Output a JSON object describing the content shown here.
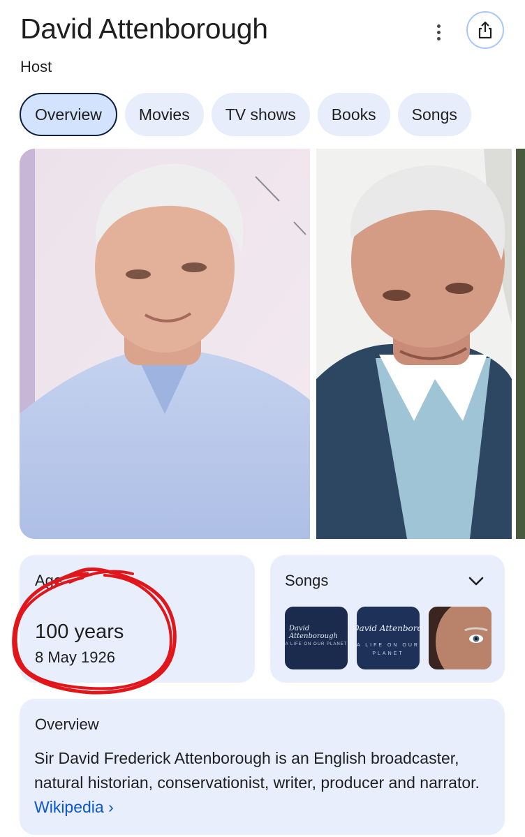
{
  "header": {
    "title": "David Attenborough",
    "subtitle": "Host",
    "menu_icon": "more-vert-icon",
    "share_icon": "share-icon"
  },
  "tabs": [
    {
      "label": "Overview",
      "active": true
    },
    {
      "label": "Movies",
      "active": false
    },
    {
      "label": "TV shows",
      "active": false
    },
    {
      "label": "Books",
      "active": false
    },
    {
      "label": "Songs",
      "active": false
    }
  ],
  "age_card": {
    "label": "Age",
    "value": "100 years",
    "birth_date": "8 May 1926"
  },
  "songs_card": {
    "label": "Songs",
    "expand_icon": "chevron-down-icon",
    "thumbs": [
      {
        "title": "David Attenborough",
        "subtitle": "A LIFE ON OUR PLANET"
      },
      {
        "title": "David Attenborough",
        "subtitle": "A LIFE ON OUR PLANET"
      },
      {
        "title": "",
        "subtitle": ""
      }
    ]
  },
  "overview_card": {
    "label": "Overview",
    "text": "Sir David Frederick Attenborough is an English broadcaster, natural historian, conservationist, writer, producer and narrator.",
    "link_label": "Wikipedia",
    "link_arrow": "›"
  },
  "colors": {
    "accent": "#0b57d0",
    "card_bg": "#e8eefc",
    "annotation_red": "#e0161b"
  }
}
